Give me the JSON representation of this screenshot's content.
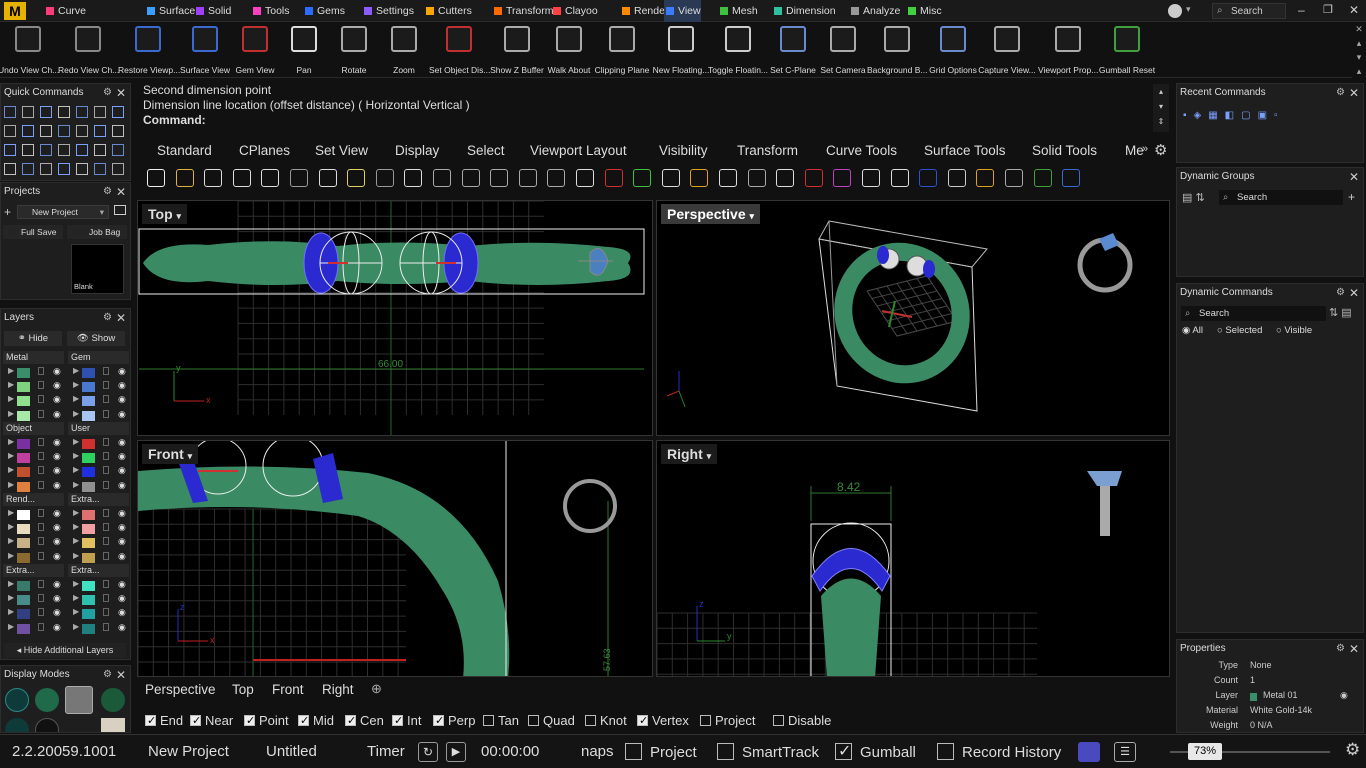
{
  "menu": {
    "logo": "M",
    "items": [
      {
        "label": "Curve",
        "color": "#ff3b7a"
      },
      {
        "label": "Surface",
        "color": "#3aa0ff"
      },
      {
        "label": "Solid",
        "color": "#a040ff"
      },
      {
        "label": "Tools",
        "color": "#ff40c0"
      },
      {
        "label": "Gems",
        "color": "#2a6cff"
      },
      {
        "label": "Settings",
        "color": "#8a5cff"
      },
      {
        "label": "Cutters",
        "color": "#ffa500"
      },
      {
        "label": "Transform",
        "color": "#ff6a00"
      },
      {
        "label": "Clayoo",
        "color": "#ff4040"
      },
      {
        "label": "Render",
        "color": "#ff8a00"
      },
      {
        "label": "View",
        "color": "#3a7bff"
      },
      {
        "label": "Mesh",
        "color": "#40c040"
      },
      {
        "label": "Dimension",
        "color": "#30c0a0"
      },
      {
        "label": "Analyze",
        "color": "#999999"
      },
      {
        "label": "Misc",
        "color": "#40d040"
      }
    ],
    "active": "View",
    "search_placeholder": "Search"
  },
  "ribbon": [
    "Undo View Ch...",
    "Redo View Ch...",
    "Restore Viewp...",
    "Surface View",
    "Gem View",
    "Pan",
    "Rotate",
    "Zoom",
    "Set Object Dis...",
    "Show Z Buffer",
    "Walk About",
    "Clipping Plane",
    "New Floating...",
    "Toggle Floatin...",
    "Set C-Plane",
    "Set Camera",
    "Background B...",
    "Grid Options",
    "Capture View...",
    "Viewport Prop...",
    "Gumball Reset"
  ],
  "panels": {
    "quick_commands": "Quick Commands",
    "projects": "Projects",
    "new_project_select": "New Project",
    "full_save": "Full Save",
    "job_bag": "Job Bag",
    "blank": "Blank",
    "layers": "Layers",
    "hide": "Hide",
    "show": "Show",
    "layer_groups": [
      {
        "name": "Metal",
        "colors": [
          "#3a8f6a",
          "#7fd07f",
          "#90e090",
          "#a8e8a8"
        ]
      },
      {
        "name": "Gem",
        "colors": [
          "#3050b0",
          "#4a78d0",
          "#7aa0e8",
          "#a8c4f0"
        ]
      },
      {
        "name": "Object",
        "colors": [
          "#7a30a0",
          "#c040a0",
          "#c05030",
          "#e08040"
        ]
      },
      {
        "name": "User",
        "colors": [
          "#d03030",
          "#30d060",
          "#2030e0",
          "#909090"
        ]
      },
      {
        "name": "Rend...",
        "colors": [
          "#ffffff",
          "#e8dcc0",
          "#c8b088",
          "#8a6a30"
        ]
      },
      {
        "name": "Extra...",
        "colors": [
          "#e07070",
          "#f0a0a0",
          "#e0c060",
          "#c0a050"
        ]
      },
      {
        "name": "Extra...",
        "colors": [
          "#3a7a6a",
          "#4a8a8a",
          "#304080",
          "#7050a0"
        ]
      },
      {
        "name": "Extra...",
        "colors": [
          "#40e0c0",
          "#30c0b0",
          "#20a0a0",
          "#208080"
        ]
      }
    ],
    "hide_additional": "Hide Additional Layers",
    "display_modes": "Display Modes",
    "recent_commands": "Recent Commands",
    "dynamic_groups": "Dynamic Groups",
    "dynamic_commands": "Dynamic Commands",
    "search": "Search",
    "filter_all": "All",
    "filter_selected": "Selected",
    "filter_visible": "Visible"
  },
  "command": {
    "line1": "Second dimension point",
    "line2": "Dimension line location (offset distance) ( Horizontal  Vertical )",
    "prompt": "Command:"
  },
  "toolbar_tabs": [
    "Standard",
    "CPlanes",
    "Set View",
    "Display",
    "Select",
    "Viewport Layout",
    "Visibility",
    "Transform",
    "Curve Tools",
    "Surface Tools",
    "Solid Tools",
    "Me"
  ],
  "viewports": {
    "top": {
      "label": "Top",
      "dim": "66.00"
    },
    "perspective": {
      "label": "Perspective"
    },
    "front": {
      "label": "Front",
      "dim": "57.63"
    },
    "right": {
      "label": "Right",
      "dim": "8.42"
    }
  },
  "view_tabs": [
    "Perspective",
    "Top",
    "Front",
    "Right"
  ],
  "osnaps": [
    {
      "label": "End",
      "on": true
    },
    {
      "label": "Near",
      "on": true
    },
    {
      "label": "Point",
      "on": true
    },
    {
      "label": "Mid",
      "on": true
    },
    {
      "label": "Cen",
      "on": true
    },
    {
      "label": "Int",
      "on": true
    },
    {
      "label": "Perp",
      "on": true
    },
    {
      "label": "Tan",
      "on": false
    },
    {
      "label": "Quad",
      "on": false
    },
    {
      "label": "Knot",
      "on": false
    },
    {
      "label": "Vertex",
      "on": true
    },
    {
      "label": "Project",
      "on": false
    },
    {
      "label": "Disable",
      "on": false
    }
  ],
  "status": {
    "version": "2.2.20059.1001",
    "project": "New Project",
    "file": "Untitled",
    "timer_label": "Timer",
    "time": "00:00:00",
    "snaps_partial": "naps",
    "project_toggle": "Project",
    "smarttrack": "SmartTrack",
    "gumball": "Gumball",
    "record_history": "Record History",
    "zoom": "73%"
  },
  "properties": {
    "title": "Properties",
    "rows": [
      {
        "k": "Type",
        "v": "None"
      },
      {
        "k": "Count",
        "v": "1"
      },
      {
        "k": "Layer",
        "v": "Metal 01"
      },
      {
        "k": "Material",
        "v": "White Gold-14k"
      },
      {
        "k": "Weight",
        "v": "0 N/A"
      }
    ]
  }
}
